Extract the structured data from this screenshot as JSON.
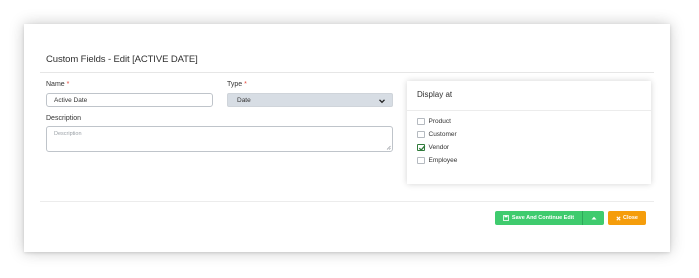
{
  "dialog": {
    "title": "Custom Fields - Edit [ACTIVE DATE]"
  },
  "form": {
    "name_label": "Name",
    "required_marker": "*",
    "name_value": "Active Date",
    "type_label": "Type",
    "type_value": "Date",
    "description_label": "Description",
    "description_placeholder": "Description"
  },
  "display_at": {
    "title": "Display at",
    "options": [
      {
        "label": "Product",
        "checked": false
      },
      {
        "label": "Customer",
        "checked": false
      },
      {
        "label": "Vendor",
        "checked": true
      },
      {
        "label": "Employee",
        "checked": false
      }
    ]
  },
  "actions": {
    "save_continue_label": "Save And Continue Edit",
    "close_label": "Close"
  },
  "colors": {
    "save_green": "#3fcb6e",
    "close_orange": "#f59d0b",
    "required_red": "#e5483b",
    "check_green": "#2f7a3a"
  }
}
